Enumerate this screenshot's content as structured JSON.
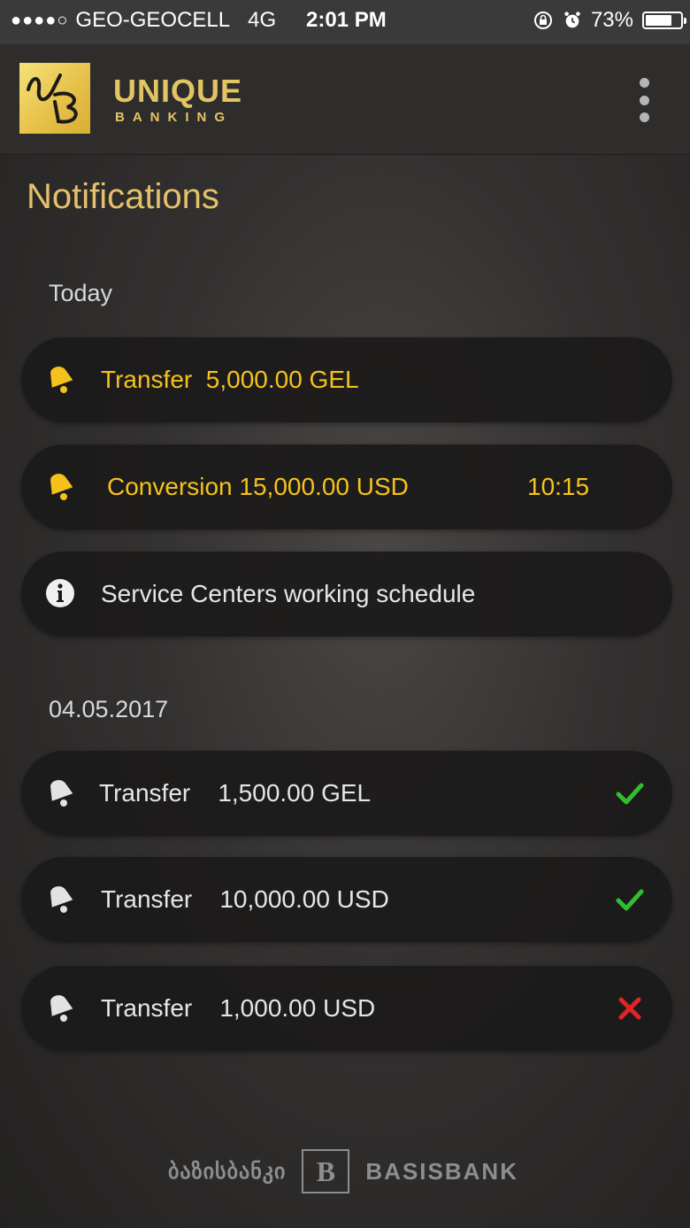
{
  "status_bar": {
    "carrier": "GEO-GEOCELL",
    "network": "4G",
    "time": "2:01 PM",
    "battery": "73%",
    "signal_icon": "signal-dots-icon",
    "lock_icon": "rotation-lock-icon",
    "alarm_icon": "alarm-icon"
  },
  "header": {
    "brand_name": "UNIQUE",
    "brand_sub": "BANKING",
    "logo_icon": "ub-logo-icon",
    "menu_icon": "kebab-menu-icon"
  },
  "page": {
    "title": "Notifications"
  },
  "sections": [
    {
      "label": "Today",
      "items": [
        {
          "icon": "bell-icon",
          "text": "Transfer  5,000.00 GEL",
          "time": "",
          "status": "",
          "color": "#f5c21b"
        },
        {
          "icon": "bell-icon",
          "text": "Conversion 15,000.00 USD",
          "time": "10:15",
          "status": "",
          "color": "#f5c21b"
        },
        {
          "icon": "info-icon",
          "text": "Service Centers working schedule",
          "time": "",
          "status": "",
          "color": "#e6e6e6"
        }
      ]
    },
    {
      "label": "04.05.2017",
      "items": [
        {
          "icon": "bell-icon",
          "text": "Transfer    1,500.00 GEL",
          "status": "success",
          "color": "#e6e6e6"
        },
        {
          "icon": "bell-icon",
          "text": "Transfer    10,000.00 USD",
          "status": "success",
          "color": "#e6e6e6"
        },
        {
          "icon": "bell-icon",
          "text": "Transfer    1,000.00 USD",
          "status": "failed",
          "color": "#e6e6e6"
        }
      ]
    }
  ],
  "footer": {
    "georgian_name": "ბაზისბანკი",
    "logo_letter": "B",
    "english_name": "BASISBANK"
  },
  "colors": {
    "accent_gold": "#e3c06a",
    "unread_gold": "#f5c21b",
    "success_green": "#2fbf2f",
    "error_red": "#e02424"
  }
}
